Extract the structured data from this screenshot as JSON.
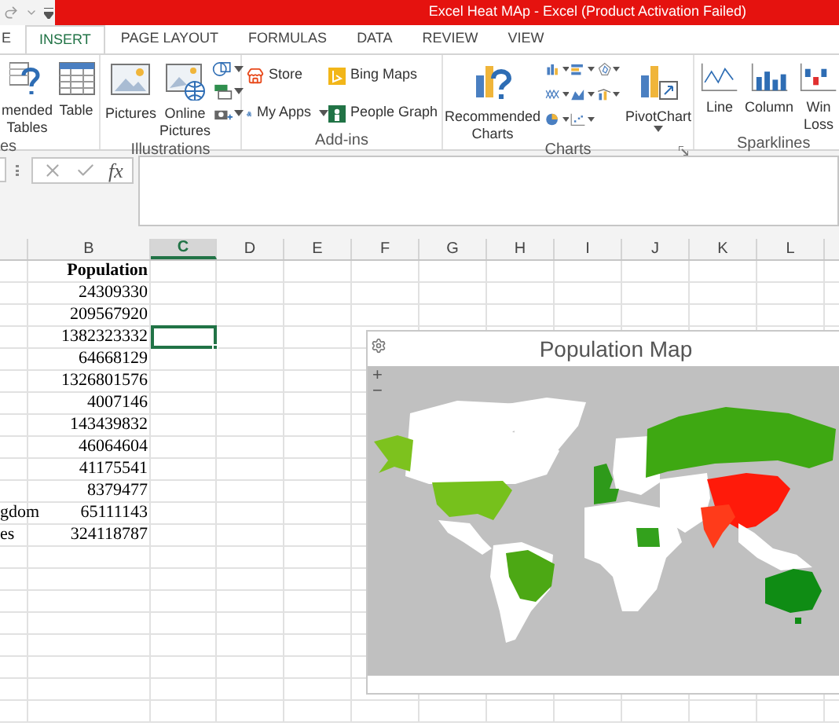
{
  "title_bar": {
    "title": "Excel Heat MAp -  Excel (Product Activation Failed)"
  },
  "ribbon_tabs": [
    {
      "label": "E",
      "selected": false
    },
    {
      "label": "INSERT",
      "selected": true
    },
    {
      "label": "PAGE LAYOUT",
      "selected": false
    },
    {
      "label": "FORMULAS",
      "selected": false
    },
    {
      "label": "DATA",
      "selected": false
    },
    {
      "label": "REVIEW",
      "selected": false
    },
    {
      "label": "VIEW",
      "selected": false
    }
  ],
  "ribbon": {
    "tables": {
      "label": "es",
      "buttons": [
        {
          "lines": [
            "mended",
            "Tables"
          ]
        },
        {
          "lines": [
            "Table"
          ]
        }
      ]
    },
    "illustrations": {
      "label": "Illustrations",
      "buttons": [
        {
          "lines": [
            "Pictures"
          ]
        },
        {
          "lines": [
            "Online",
            "Pictures"
          ]
        }
      ]
    },
    "addins": {
      "label": "Add-ins",
      "buttons": [
        {
          "label": "Store"
        },
        {
          "label": "Bing Maps"
        },
        {
          "label": "My Apps"
        },
        {
          "label": "People Graph"
        }
      ]
    },
    "charts": {
      "label": "Charts",
      "buttons": [
        {
          "lines": [
            "Recommended",
            "Charts"
          ]
        },
        {
          "lines": [
            "PivotChart"
          ]
        }
      ]
    },
    "sparklines": {
      "label": "Sparklines",
      "buttons": [
        {
          "lines": [
            "Line"
          ]
        },
        {
          "lines": [
            "Column"
          ]
        },
        {
          "lines": [
            "Win",
            "Loss"
          ]
        }
      ]
    }
  },
  "formula_bar": {
    "function_label": "fx"
  },
  "columns": [
    {
      "label": "B",
      "selected": false
    },
    {
      "label": "C",
      "selected": true
    },
    {
      "label": "D",
      "selected": false
    },
    {
      "label": "E",
      "selected": false
    },
    {
      "label": "F",
      "selected": false
    },
    {
      "label": "G",
      "selected": false
    },
    {
      "label": "H",
      "selected": false
    },
    {
      "label": "I",
      "selected": false
    },
    {
      "label": "J",
      "selected": false
    },
    {
      "label": "K",
      "selected": false
    },
    {
      "label": "L",
      "selected": false
    }
  ],
  "rows": [
    {
      "kind": "header",
      "b": "Population",
      "c_selected": false
    },
    {
      "kind": "number",
      "b": "24309330",
      "c_selected": false
    },
    {
      "kind": "number",
      "b": "209567920",
      "c_selected": false
    },
    {
      "kind": "number",
      "b": "1382323332",
      "c_selected": true
    },
    {
      "kind": "number",
      "b": "64668129",
      "c_selected": false
    },
    {
      "kind": "number",
      "b": "1326801576",
      "c_selected": false
    },
    {
      "kind": "number",
      "b": "4007146",
      "c_selected": false
    },
    {
      "kind": "number",
      "b": "143439832",
      "c_selected": false
    },
    {
      "kind": "number",
      "b": "46064604",
      "c_selected": false
    },
    {
      "kind": "number",
      "b": "41175541",
      "c_selected": false
    },
    {
      "kind": "number",
      "b": "8379477",
      "c_selected": false
    },
    {
      "kind": "number",
      "a": "gdom",
      "b": "65111143",
      "c_selected": false
    },
    {
      "kind": "number",
      "a": "es",
      "b": "324118787",
      "c_selected": false
    }
  ],
  "map_chart": {
    "title": "Population Map",
    "zoom_in": "+",
    "zoom_out": "−"
  }
}
